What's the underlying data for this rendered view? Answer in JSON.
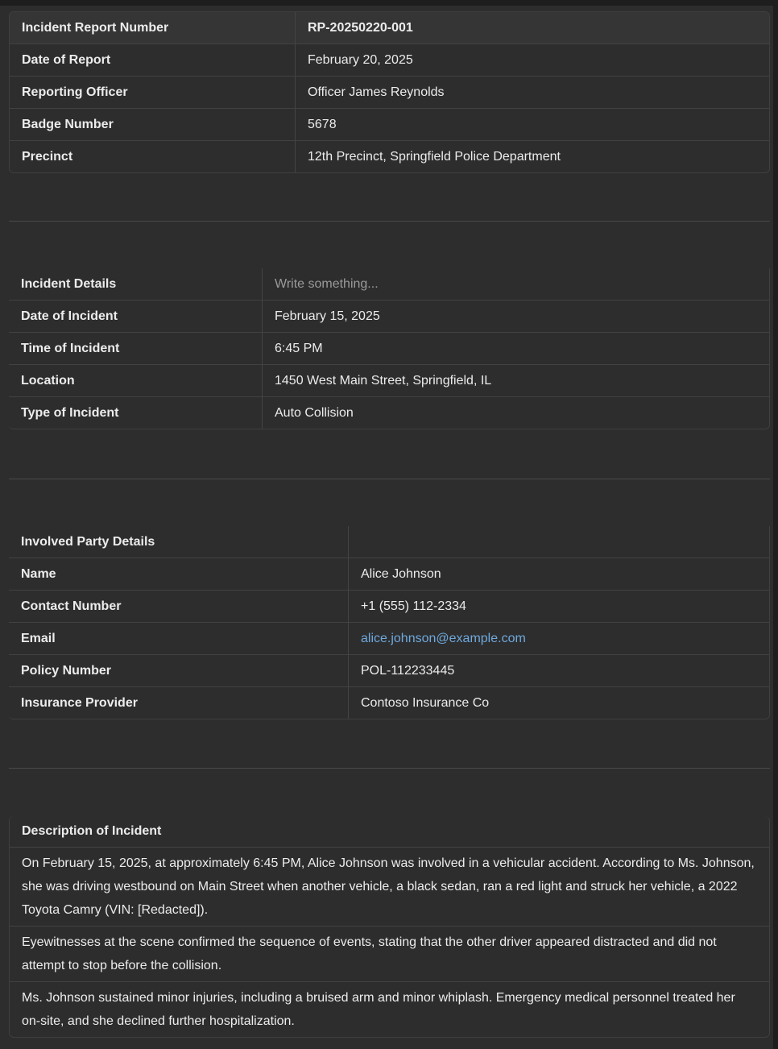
{
  "report_table": {
    "rows": [
      {
        "label": "Incident Report Number",
        "value": "RP-20250220-001"
      },
      {
        "label": "Date of Report",
        "value": "February 20, 2025"
      },
      {
        "label": "Reporting Officer",
        "value": "Officer James Reynolds"
      },
      {
        "label": "Badge Number",
        "value": "5678"
      },
      {
        "label": "Precinct",
        "value": "12th Precinct, Springfield Police Department"
      }
    ]
  },
  "incident_table": {
    "header_label": "Incident Details",
    "header_placeholder": "Write something...",
    "rows": [
      {
        "label": "Date of Incident",
        "value": "February 15, 2025"
      },
      {
        "label": "Time of Incident",
        "value": "6:45 PM"
      },
      {
        "label": "Location",
        "value": "1450 West Main Street, Springfield, IL"
      },
      {
        "label": "Type of Incident",
        "value": "Auto Collision"
      }
    ]
  },
  "party_table": {
    "header_label": "Involved Party Details",
    "header_value": "",
    "rows": [
      {
        "label": "Name",
        "value": "Alice Johnson"
      },
      {
        "label": "Contact Number",
        "value": "+1 (555) 112-2334"
      },
      {
        "label": "Email",
        "value": "alice.johnson@example.com"
      },
      {
        "label": "Policy Number",
        "value": "POL-112233445"
      },
      {
        "label": "Insurance Provider",
        "value": "Contoso Insurance Co"
      }
    ]
  },
  "description_table": {
    "header": "Description of Incident",
    "paragraphs": [
      "On February 15, 2025, at approximately 6:45 PM, Alice Johnson was involved in a vehicular accident. According to Ms. Johnson, she was driving westbound on Main Street when another vehicle, a black sedan, ran a red light and struck her vehicle, a 2022 Toyota Camry (VIN: [Redacted]).",
      "Eyewitnesses at the scene confirmed the sequence of events, stating that the other driver appeared distracted and did not attempt to stop before the collision.",
      "Ms. Johnson sustained minor injuries, including a bruised arm and minor whiplash. Emergency medical personnel treated her on-site, and she declined further hospitalization."
    ]
  },
  "colors": {
    "background": "#2d2d2d",
    "text": "#ececec",
    "link": "#6fa8dc",
    "placeholder": "#9a9a9a"
  }
}
